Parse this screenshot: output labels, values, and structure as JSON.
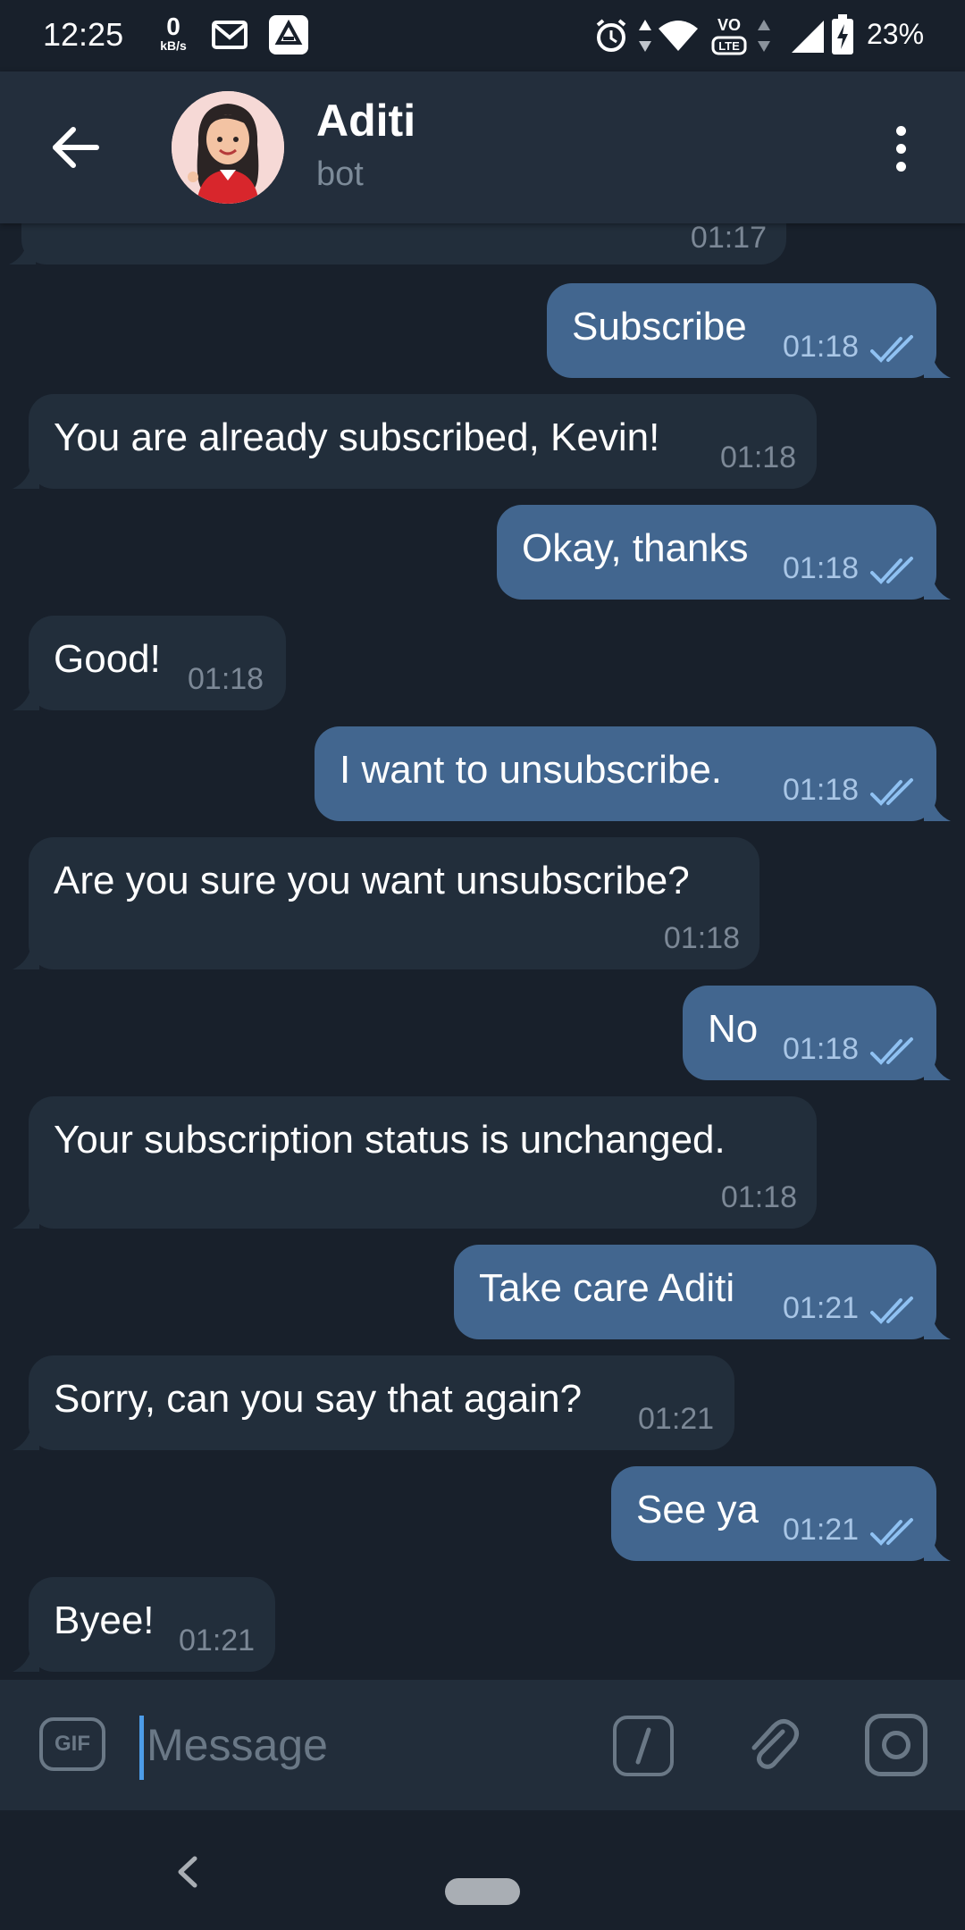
{
  "status_bar": {
    "time": "12:25",
    "net_speed_value": "0",
    "net_speed_unit": "kB/s",
    "network_type": "VoLTE",
    "battery": "23%",
    "icons": [
      "gmail-icon",
      "drive-icon",
      "alarm-icon",
      "data-arrows-icon",
      "wifi-icon",
      "volte-icon",
      "signal-icon",
      "battery-charging-icon"
    ]
  },
  "header": {
    "title": "Aditi",
    "subtitle": "bot",
    "back_icon": "arrow-left-icon",
    "menu_icon": "more-vertical-icon"
  },
  "messages": [
    {
      "dir": "in",
      "text": "",
      "time": "01:17"
    },
    {
      "dir": "out",
      "text": "Subscribe",
      "time": "01:18",
      "read": true
    },
    {
      "dir": "in",
      "text": "You are already subscribed, Kevin!",
      "time": "01:18"
    },
    {
      "dir": "out",
      "text": "Okay, thanks",
      "time": "01:18",
      "read": true
    },
    {
      "dir": "in",
      "text": "Good!",
      "time": "01:18"
    },
    {
      "dir": "out",
      "text": "I want to unsubscribe.",
      "time": "01:18",
      "read": true
    },
    {
      "dir": "in",
      "text": "Are you sure you want unsubscribe?",
      "time": "01:18"
    },
    {
      "dir": "out",
      "text": "No",
      "time": "01:18",
      "read": true
    },
    {
      "dir": "in",
      "text": "Your subscription status is unchanged.",
      "time": "01:18"
    },
    {
      "dir": "out",
      "text": "Take care Aditi",
      "time": "01:21",
      "read": true
    },
    {
      "dir": "in",
      "text": "Sorry, can you say that again?",
      "time": "01:21"
    },
    {
      "dir": "out",
      "text": "See ya",
      "time": "01:21",
      "read": true
    },
    {
      "dir": "in",
      "text": "Byee!",
      "time": "01:21"
    }
  ],
  "composer": {
    "gif_label": "GIF",
    "placeholder": "Message",
    "value": ""
  },
  "colors": {
    "background": "#18202b",
    "header": "#232e3c",
    "incoming_bubble": "#222e3b",
    "outgoing_bubble": "#42668f",
    "read_ticks": "#8fc1f2",
    "accent_cursor": "#4c9ce8"
  }
}
